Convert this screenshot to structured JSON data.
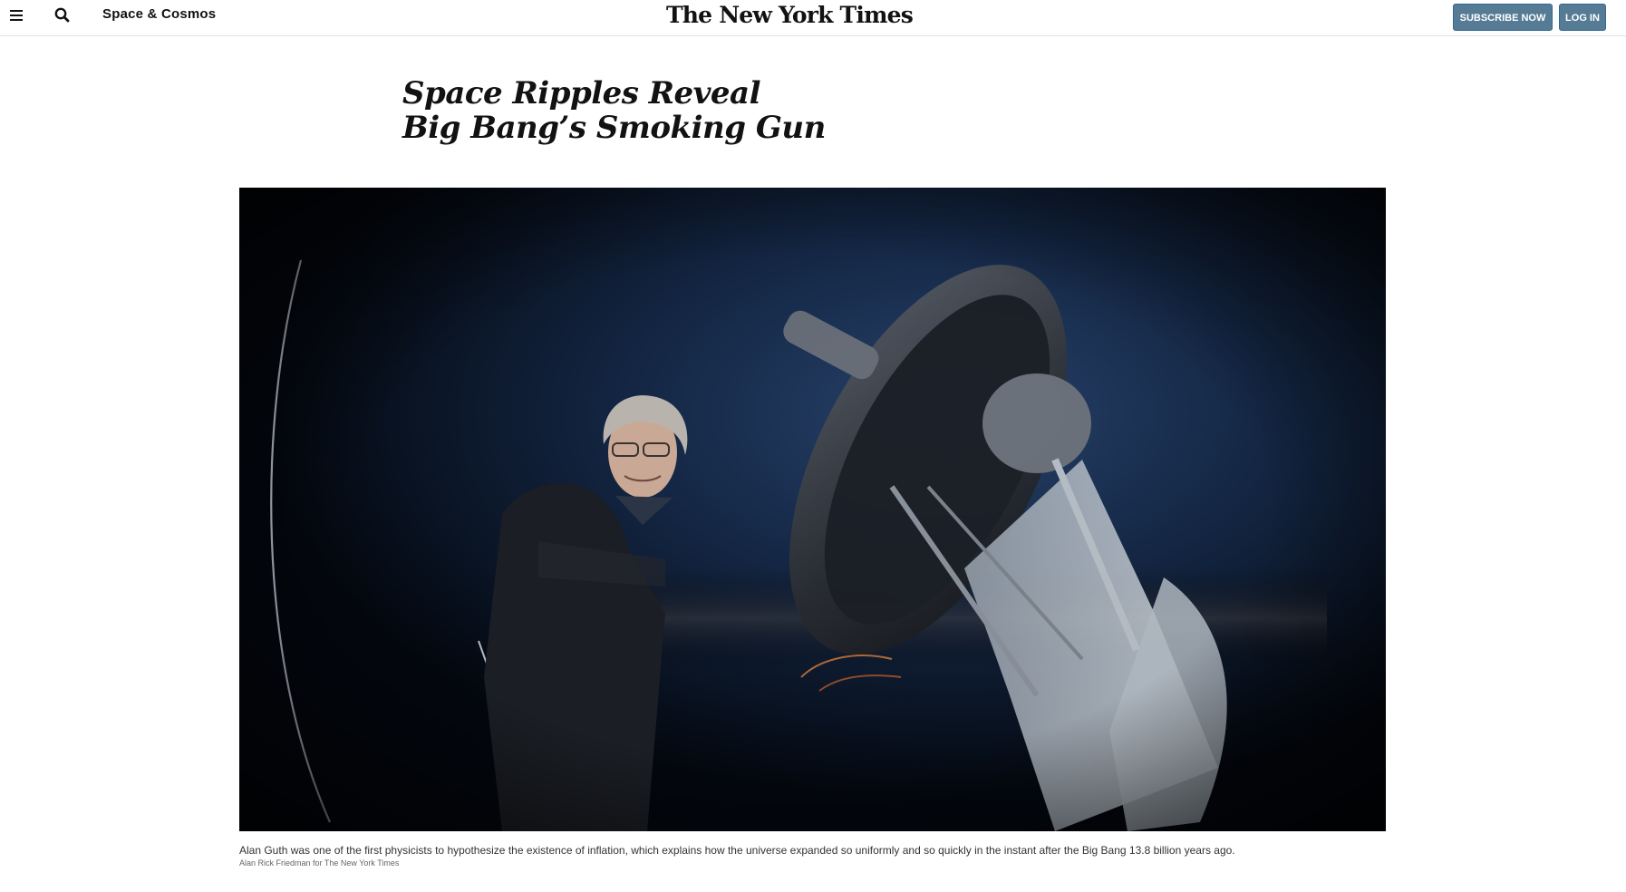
{
  "header": {
    "menu_icon": "hamburger-menu-icon",
    "search_icon": "search-icon",
    "section": "Space & Cosmos",
    "logo": "The New York Times",
    "subscribe_label": "SUBSCRIBE NOW",
    "login_label": "LOG IN",
    "button_color": "#567b95"
  },
  "article": {
    "headline_line1": "Space Ripples Reveal",
    "headline_line2": "Big Bang’s Smoking Gun",
    "caption": "Alan Guth was one of the first physicists to hypothesize the existence of inflation, which explains how the universe expanded so uniformly and so quickly in the instant after the Big Bang 13.8 billion years ago.",
    "credit": "Alan Rick Friedman for The New York Times"
  }
}
